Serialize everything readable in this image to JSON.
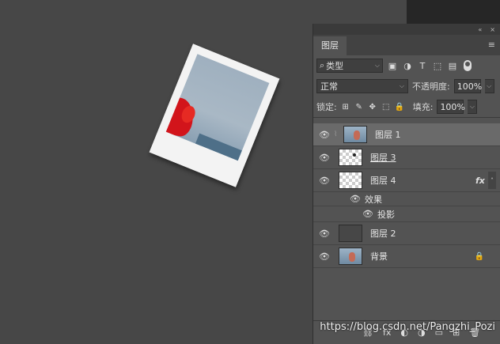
{
  "panel": {
    "collapse_icon": "«",
    "close_icon": "×",
    "tab_label": "图层",
    "menu_icon": "≡"
  },
  "filter": {
    "search_icon": "⌕",
    "kind_label": "类型",
    "chevron": "⌵",
    "icons": [
      "▣",
      "◑",
      "T",
      "⬚",
      "▤"
    ]
  },
  "blend": {
    "mode": "正常",
    "chevron": "⌵",
    "opacity_label": "不透明度:",
    "opacity_value": "100%"
  },
  "lock": {
    "label": "锁定:",
    "icons": [
      "⊞",
      "✎",
      "✥",
      "⬚",
      "🔒"
    ],
    "fill_label": "填充:",
    "fill_value": "100%"
  },
  "layers": [
    {
      "name": "图层 1",
      "visible": true,
      "selected": true,
      "thumb": "photo",
      "clipped": true
    },
    {
      "name": "图层 3",
      "visible": true,
      "thumb": "transparent",
      "underline": true
    },
    {
      "name": "图层 4",
      "visible": true,
      "thumb": "transparent",
      "fx": "fx",
      "fx_caret": "˄"
    },
    {
      "name": "图层 2",
      "visible": true,
      "thumb": "dark"
    },
    {
      "name": "背景",
      "visible": true,
      "thumb": "photo",
      "locked": true
    }
  ],
  "effects": {
    "label": "效果",
    "drop_shadow_label": "投影"
  },
  "icons": {
    "eye": "👁",
    "lock": "🔒",
    "chain": "⌇"
  },
  "bottom_icons": [
    "⛓",
    "fx",
    "◐",
    "◑",
    "▭",
    "⊞",
    "🗑"
  ],
  "watermark": "https://blog.csdn.net/Pangzhi_Pozi"
}
